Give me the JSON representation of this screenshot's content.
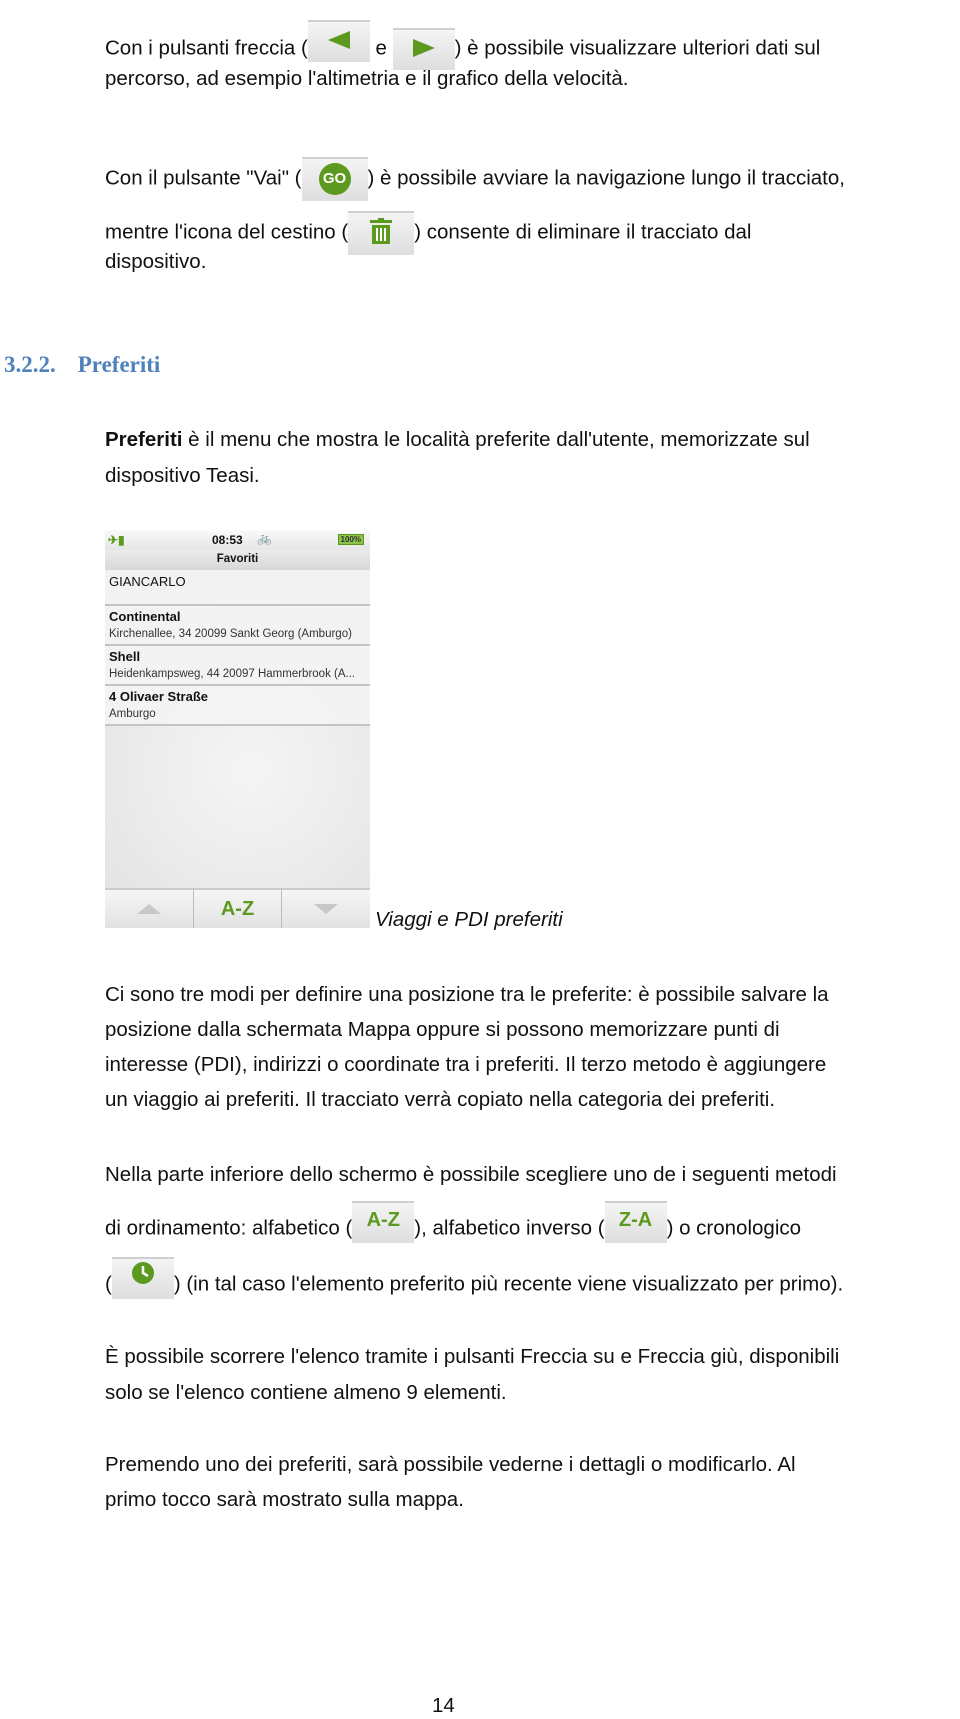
{
  "intro": {
    "line1_a": "Con i pulsanti freccia (",
    "line1_b": "e",
    "line1_c": ") è possibile visualizzare ulteriori dati sul",
    "line2": "percorso, ad esempio l'altimetria e il grafico della velocità.",
    "line3_a": "Con il pulsante \"Vai\" (",
    "go_label": "GO",
    "line3_b": ") è possibile avviare la navigazione lungo il tracciato,",
    "line4_a": "mentre l'icona del cestino (",
    "line4_b": ") consente di eliminare il tracciato dal",
    "line5": "dispositivo."
  },
  "section": {
    "number": "3.2.2.",
    "title": "Preferiti"
  },
  "para1": {
    "bold": "Preferiti",
    "line1": " è il menu che mostra le località preferite dall'utente, memorizzate sul",
    "line2": "dispositivo Teasi."
  },
  "device": {
    "time": "08:53",
    "battery": "100%",
    "title": "Favoriti",
    "user": "GIANCARLO",
    "items": [
      {
        "name": "Continental",
        "address": "Kirchenallee, 34 20099 Sankt Georg (Amburgo)"
      },
      {
        "name": "Shell",
        "address": "Heidenkampsweg, 44 20097 Hammerbrook (A..."
      },
      {
        "name": "4 Olivaer Straße",
        "address": "Amburgo"
      }
    ],
    "sort_label": "A-Z",
    "accent": "#5b9a1e"
  },
  "caption": "Viaggi e PDI preferiti",
  "para2": [
    "Ci sono tre modi per definire una posizione tra le preferite: è possibile salvare la",
    "posizione dalla schermata Mappa oppure si possono memorizzare punti di",
    "interesse (PDI), indirizzi o coordinate tra i preferiti. Il terzo metodo è aggiungere",
    "un viaggio ai preferiti. Il tracciato verrà copiato nella categoria dei preferiti."
  ],
  "para3": {
    "line1": "Nella parte inferiore dello schermo è possibile scegliere uno de i seguenti metodi",
    "line2_a": "di ordinamento: alfabetico (",
    "az": "A-Z",
    "line2_b": "), alfabetico inverso (",
    "za": "Z-A",
    "line2_c": ") o cronologico",
    "line3_a": "(",
    "line3_b": ") (in tal caso l'elemento preferito più recente viene visualizzato per primo)."
  },
  "para4": [
    "È possibile scorrere l'elenco tramite i pulsanti Freccia su e Freccia giù, disponibili",
    "solo se l'elenco contiene almeno 9 elementi."
  ],
  "para5": [
    "Premendo uno dei preferiti, sarà possibile vederne i dettagli o modificarlo. Al",
    "primo tocco sarà mostrato sulla mappa."
  ],
  "page_number": "14",
  "heading_color": "#4f81bd"
}
